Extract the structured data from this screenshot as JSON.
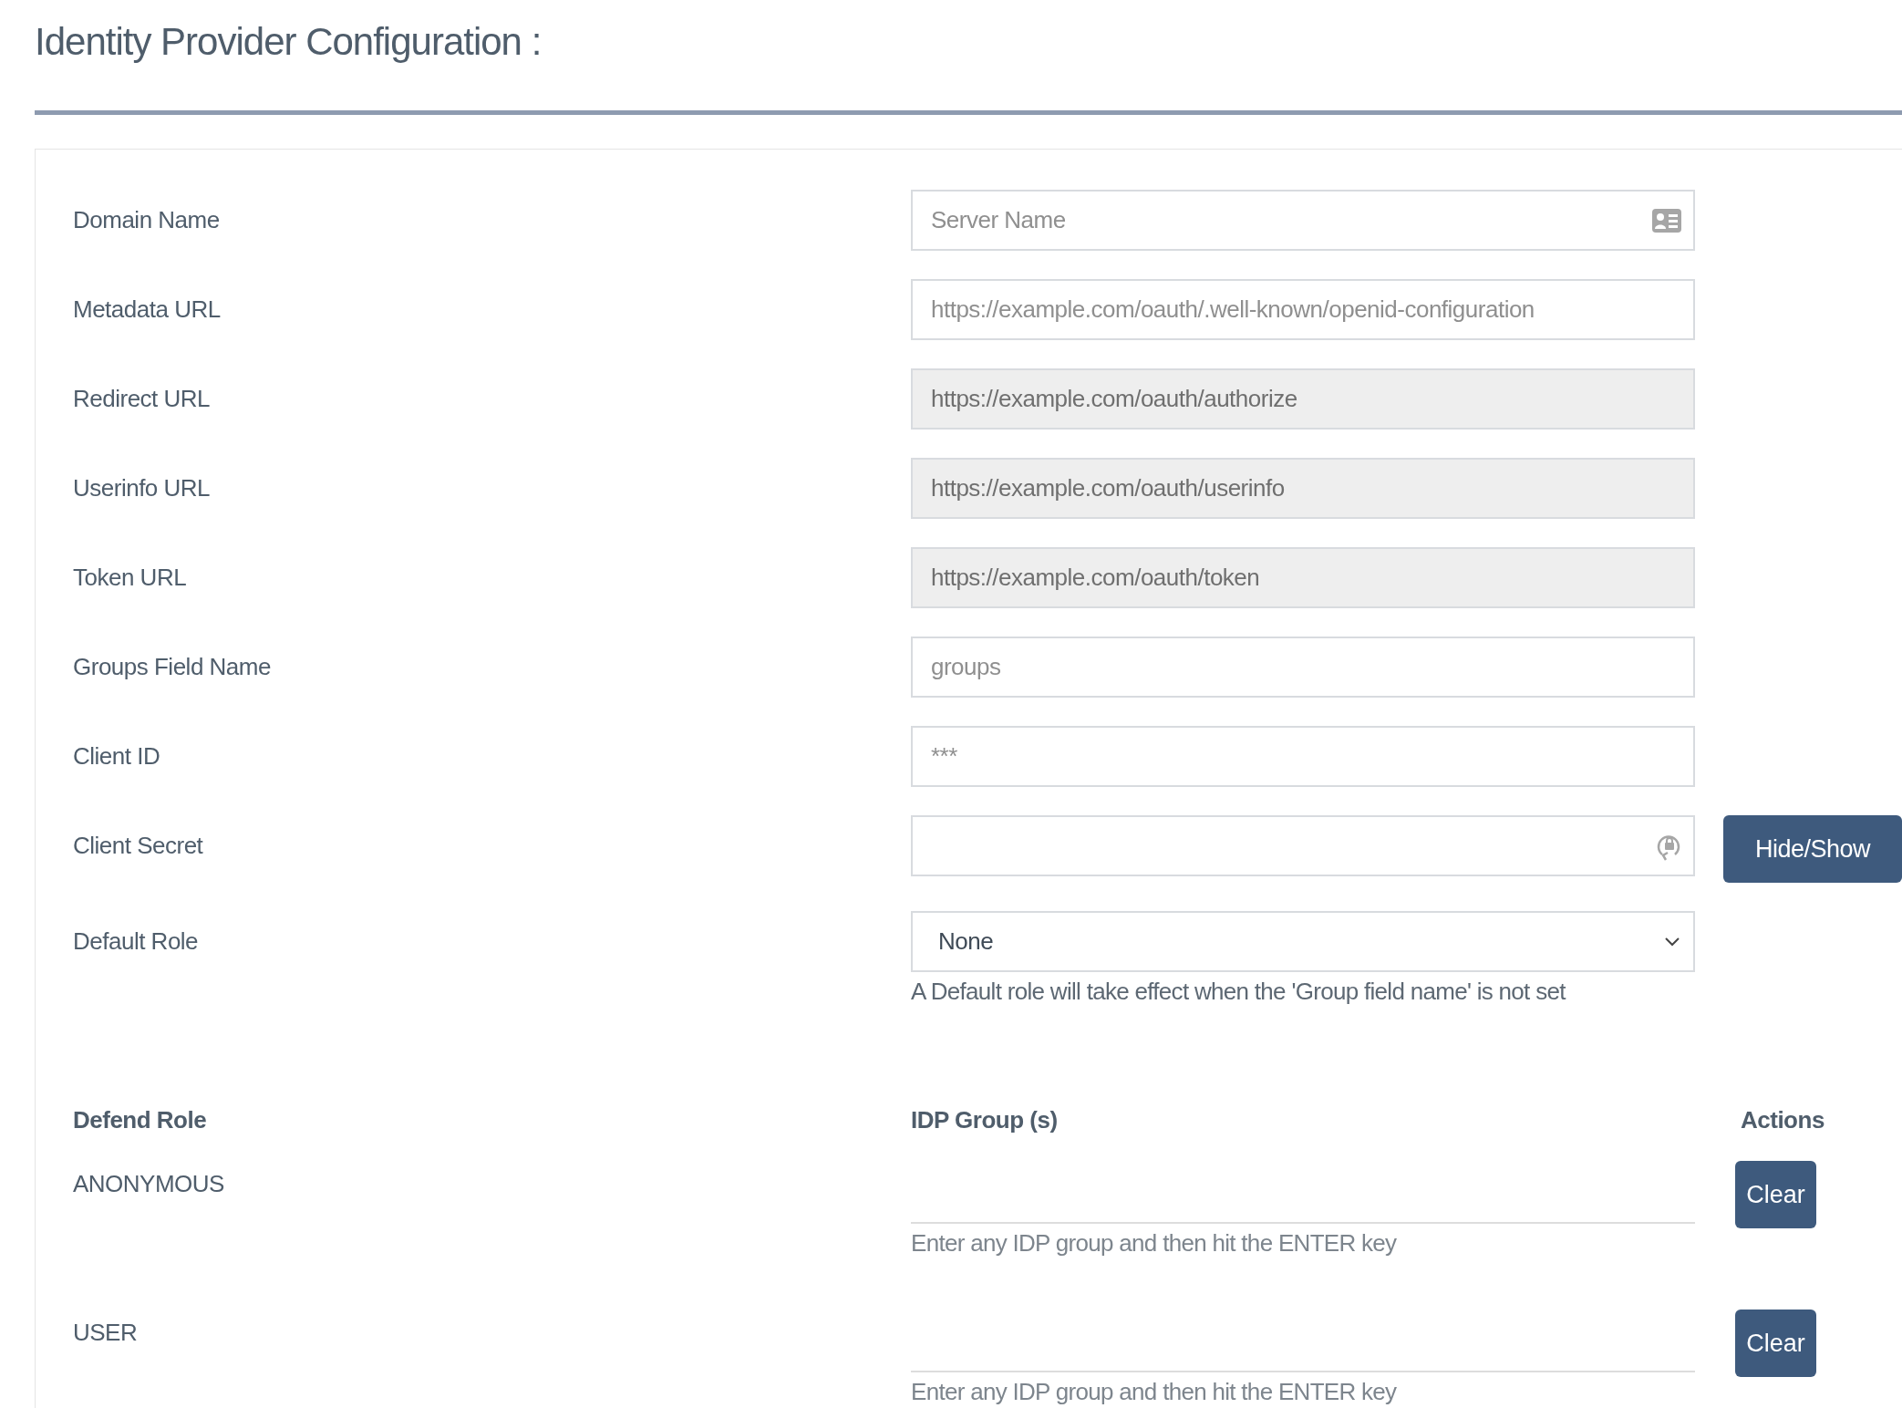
{
  "title": "Identity Provider Configuration :",
  "fields": [
    {
      "label": "Domain Name",
      "kind": "card",
      "placeholder": "Server Name",
      "disabled": false
    },
    {
      "label": "Metadata URL",
      "kind": "text",
      "placeholder": "https://example.com/oauth/.well-known/openid-configuration",
      "disabled": false
    },
    {
      "label": "Redirect URL",
      "kind": "text",
      "value": "https://example.com/oauth/authorize",
      "disabled": true
    },
    {
      "label": "Userinfo URL",
      "kind": "text",
      "value": "https://example.com/oauth/userinfo",
      "disabled": true
    },
    {
      "label": "Token URL",
      "kind": "text",
      "value": "https://example.com/oauth/token",
      "disabled": true
    },
    {
      "label": "Groups Field Name",
      "kind": "text",
      "placeholder": "groups",
      "disabled": false
    },
    {
      "label": "Client ID",
      "kind": "text",
      "placeholder": "***",
      "disabled": false
    },
    {
      "label": "Client Secret",
      "kind": "secret",
      "disabled": false,
      "button": "Hide/Show"
    },
    {
      "label": "Default Role",
      "kind": "select",
      "value": "None",
      "help": "A Default role will take effect when the 'Group field name' is not set"
    }
  ],
  "roles_table": {
    "columns": [
      "Defend Role",
      "IDP Group (s)",
      "Actions"
    ],
    "rows": [
      {
        "role": "ANONYMOUS",
        "hint": "Enter any IDP group and then hit the ENTER key",
        "action": "Clear"
      },
      {
        "role": "USER",
        "hint": "Enter any IDP group and then hit the ENTER key",
        "action": "Clear"
      }
    ]
  }
}
